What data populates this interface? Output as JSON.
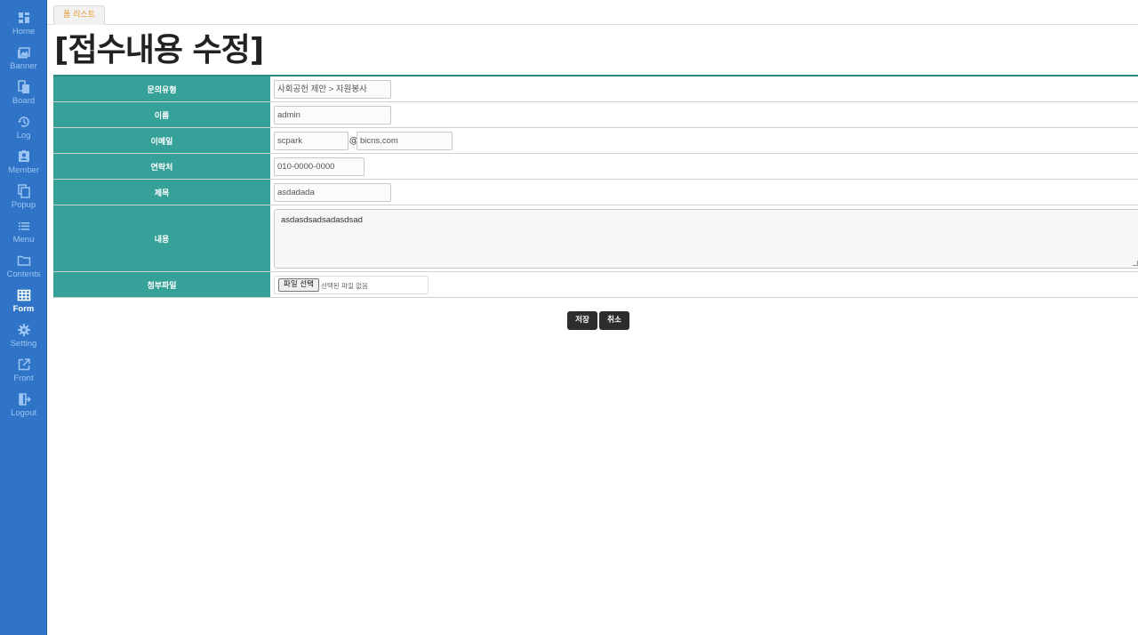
{
  "sidebar": {
    "accent": "#2f74c6",
    "items": [
      {
        "label": "Home",
        "icon": "dashboard-icon"
      },
      {
        "label": "Banner",
        "icon": "image-icon"
      },
      {
        "label": "Board",
        "icon": "board-icon"
      },
      {
        "label": "Log",
        "icon": "history-icon"
      },
      {
        "label": "Member",
        "icon": "member-icon"
      },
      {
        "label": "Popup",
        "icon": "copy-icon"
      },
      {
        "label": "Menu",
        "icon": "list-icon"
      },
      {
        "label": "Contents",
        "icon": "folder-icon"
      },
      {
        "label": "Form",
        "icon": "table-icon",
        "active": true
      },
      {
        "label": "Setting",
        "icon": "gear-icon"
      },
      {
        "label": "Front",
        "icon": "external-link-icon"
      },
      {
        "label": "Logout",
        "icon": "logout-icon"
      }
    ]
  },
  "tabs": [
    {
      "label": "폼 리스트"
    }
  ],
  "page": {
    "title": "[접수내용 수정]"
  },
  "form": {
    "header_color": "#36a198",
    "inquiry_type": {
      "label": "문의유형",
      "value": "사회공헌 제안 > 자원봉사"
    },
    "name": {
      "label": "이름",
      "value": "admin"
    },
    "email": {
      "label": "이메일",
      "local": "scpark",
      "at": "@",
      "domain": "bicns.com"
    },
    "phone": {
      "label": "연락처",
      "value": "010-0000-0000"
    },
    "subject": {
      "label": "제목",
      "value": "asdadada"
    },
    "content": {
      "label": "내용",
      "value": "asdasdsadsadasdsad"
    },
    "attachment": {
      "label": "첨부파일",
      "button": "파일 선택",
      "status": "선택된 파일 없음"
    }
  },
  "actions": {
    "save": "저장",
    "cancel": "취소"
  }
}
